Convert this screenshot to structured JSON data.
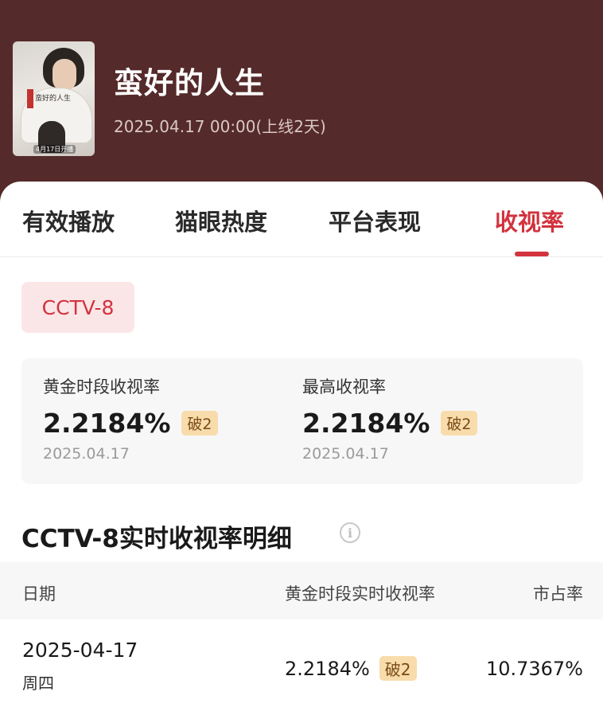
{
  "header": {
    "title": "蛮好的人生",
    "meta": "2025.04.17 00:00(上线2天)",
    "poster": {
      "text": "蛮好的人生",
      "date": "4月17日开播"
    }
  },
  "tabs": [
    {
      "label": "有效播放",
      "active": false
    },
    {
      "label": "猫眼热度",
      "active": false
    },
    {
      "label": "平台表现",
      "active": false
    },
    {
      "label": "收视率",
      "active": true
    }
  ],
  "channel": {
    "label": "CCTV-8"
  },
  "stats": {
    "prime": {
      "label": "黄金时段收视率",
      "value": "2.2184%",
      "badge": "破2",
      "date": "2025.04.17"
    },
    "peak": {
      "label": "最高收视率",
      "value": "2.2184%",
      "badge": "破2",
      "date": "2025.04.17"
    }
  },
  "detail": {
    "title": "CCTV-8实时收视率明细",
    "info_icon": "i",
    "columns": {
      "date": "日期",
      "rating": "黄金时段实时收视率",
      "share": "市占率"
    },
    "rows": [
      {
        "date": "2025-04-17",
        "weekday": "周四",
        "rating": "2.2184%",
        "badge": "破2",
        "share": "10.7367%"
      }
    ]
  },
  "colors": {
    "header_bg": "#552a2a",
    "accent": "#d2333e",
    "chip_bg": "#fbe6e7",
    "badge_bg": "#f8dcab"
  },
  "icons": {
    "info": "info-circle-icon"
  }
}
